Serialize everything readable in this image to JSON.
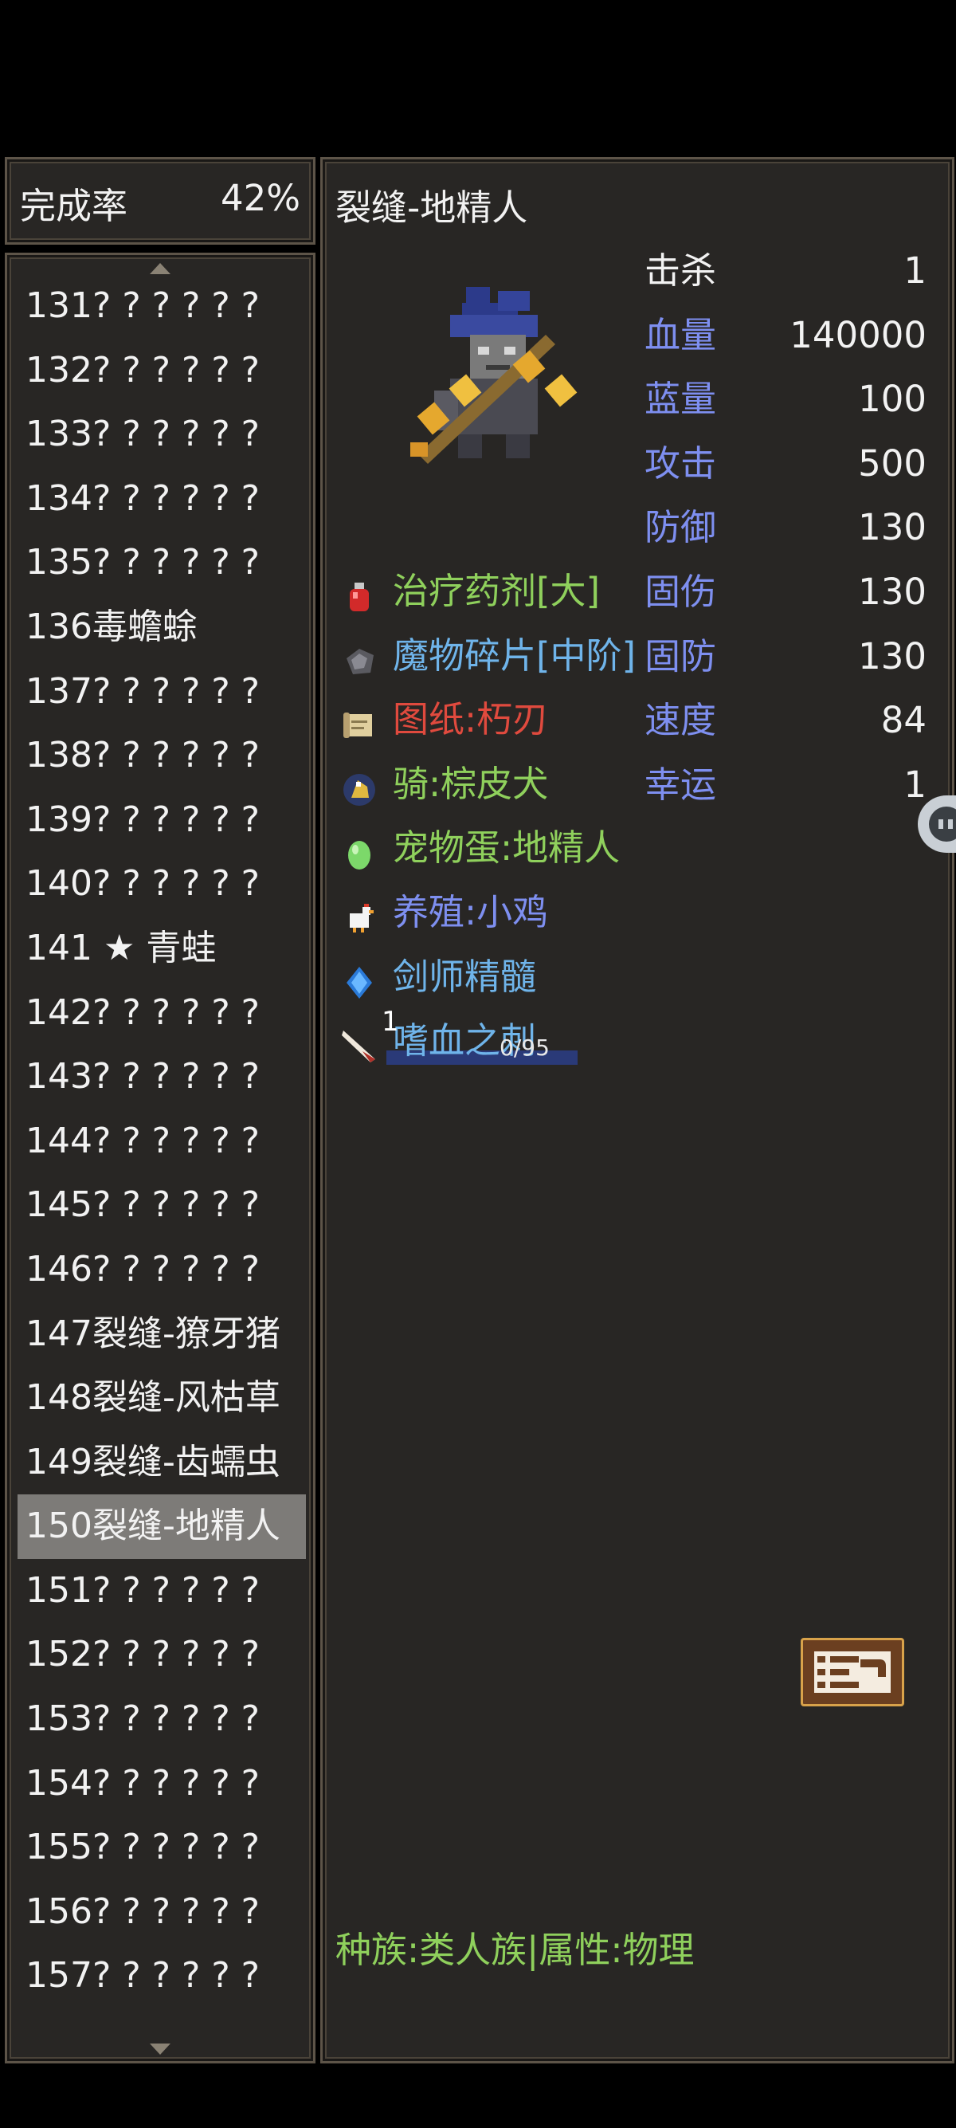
{
  "header": {
    "rate_label": "完成率",
    "rate_value": "42%"
  },
  "monster_list": [
    {
      "label": "131? ? ? ? ? ?"
    },
    {
      "label": "132? ? ? ? ? ?"
    },
    {
      "label": "133? ? ? ? ? ?"
    },
    {
      "label": "134? ? ? ? ? ?"
    },
    {
      "label": "135? ? ? ? ? ?"
    },
    {
      "label": "136毒蟾蜍"
    },
    {
      "label": "137? ? ? ? ? ?"
    },
    {
      "label": "138? ? ? ? ? ?"
    },
    {
      "label": "139? ? ? ? ? ?"
    },
    {
      "label": "140? ? ? ? ? ?"
    },
    {
      "label": "141 ★ 青蛙"
    },
    {
      "label": "142? ? ? ? ? ?"
    },
    {
      "label": "143? ? ? ? ? ?"
    },
    {
      "label": "144? ? ? ? ? ?"
    },
    {
      "label": "145? ? ? ? ? ?"
    },
    {
      "label": "146? ? ? ? ? ?"
    },
    {
      "label": "147裂缝-獠牙猪"
    },
    {
      "label": "148裂缝-风枯草"
    },
    {
      "label": "149裂缝-齿蠕虫"
    },
    {
      "label": "150裂缝-地精人",
      "selected": true
    },
    {
      "label": "151? ? ? ? ? ?"
    },
    {
      "label": "152? ? ? ? ? ?"
    },
    {
      "label": "153? ? ? ? ? ?"
    },
    {
      "label": "154? ? ? ? ? ?"
    },
    {
      "label": "155? ? ? ? ? ?"
    },
    {
      "label": "156? ? ? ? ? ?"
    },
    {
      "label": "157? ? ? ? ? ?"
    }
  ],
  "detail": {
    "name": "裂缝-地精人",
    "stats": [
      {
        "label": "击杀",
        "value": "1"
      },
      {
        "label": "血量",
        "value": "140000"
      },
      {
        "label": "蓝量",
        "value": "100"
      },
      {
        "label": "攻击",
        "value": "500"
      },
      {
        "label": "防御",
        "value": "130"
      },
      {
        "label": "固伤",
        "value": "130"
      },
      {
        "label": "固防",
        "value": "130"
      },
      {
        "label": "速度",
        "value": "84"
      },
      {
        "label": "幸运",
        "value": "1"
      }
    ],
    "drops": [
      {
        "label": "治疗药剂[大]",
        "color": "#8fd05c",
        "icon": "potion-icon"
      },
      {
        "label": "魔物碎片[中阶]",
        "color": "#6fb4ea",
        "icon": "fragment-icon"
      },
      {
        "label": "图纸:朽刃",
        "color": "#e04a3e",
        "icon": "scroll-icon"
      },
      {
        "label": "骑:棕皮犬",
        "color": "#8fd05c",
        "icon": "mount-icon"
      },
      {
        "label": "宠物蛋:地精人",
        "color": "#8fd05c",
        "icon": "egg-icon"
      },
      {
        "label": "养殖:小鸡",
        "color": "#7e8ff0",
        "icon": "chicken-icon"
      },
      {
        "label": "剑师精髓",
        "color": "#6fb4ea",
        "icon": "essence-icon"
      },
      {
        "label": "嗜血之刺",
        "color": "#6fb4ea",
        "icon": "thorn-icon",
        "count": "1",
        "progress_text": "0/95",
        "progress": 0
      }
    ],
    "race_info": "种族:类人族|属性:物理"
  }
}
